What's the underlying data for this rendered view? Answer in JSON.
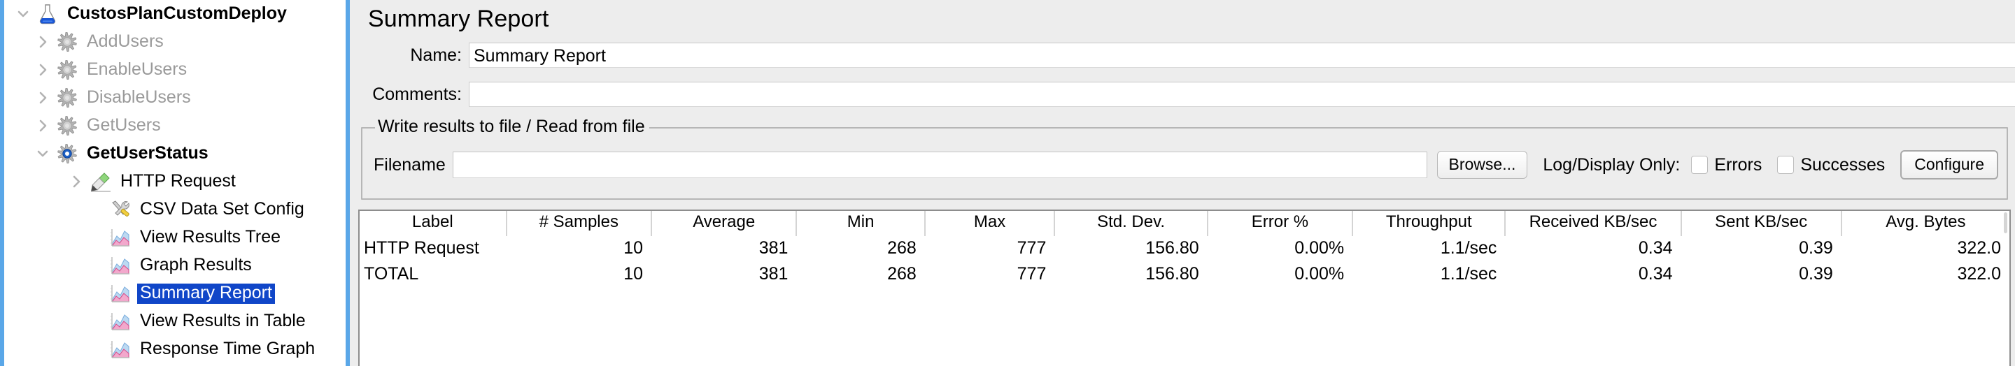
{
  "window": {
    "accent_color": "#5aa7e8",
    "panel_bg": "#ededed",
    "selection_color": "#1046c8"
  },
  "tree": {
    "items": [
      {
        "label": "CustosPlanCustomDeploy",
        "icon": "test-plan-flask-icon",
        "indent": 0,
        "twisty": "chevron-down-icon",
        "state": "enabled-bold",
        "selected": false
      },
      {
        "label": "AddUsers",
        "icon": "thread-group-gear-icon",
        "indent": 1,
        "twisty": "chevron-right-icon",
        "state": "disabled",
        "selected": false
      },
      {
        "label": "EnableUsers",
        "icon": "thread-group-gear-icon",
        "indent": 1,
        "twisty": "chevron-right-icon",
        "state": "disabled",
        "selected": false
      },
      {
        "label": "DisableUsers",
        "icon": "thread-group-gear-icon",
        "indent": 1,
        "twisty": "chevron-right-icon",
        "state": "disabled",
        "selected": false
      },
      {
        "label": "GetUsers",
        "icon": "thread-group-gear-icon",
        "indent": 1,
        "twisty": "chevron-right-icon",
        "state": "disabled",
        "selected": false
      },
      {
        "label": "GetUserStatus",
        "icon": "thread-group-gear-active-icon",
        "indent": 1,
        "twisty": "chevron-down-icon",
        "state": "enabled-bold",
        "selected": false
      },
      {
        "label": "HTTP Request",
        "icon": "http-request-pen-icon",
        "indent": 2,
        "twisty": "chevron-right-icon",
        "state": "enabled",
        "selected": false
      },
      {
        "label": "CSV Data Set Config",
        "icon": "csv-config-tools-icon",
        "indent": 3,
        "twisty": "none",
        "state": "enabled",
        "selected": false
      },
      {
        "label": "View Results Tree",
        "icon": "listener-chart-icon",
        "indent": 3,
        "twisty": "none",
        "state": "enabled",
        "selected": false
      },
      {
        "label": "Graph Results",
        "icon": "listener-chart-icon",
        "indent": 3,
        "twisty": "none",
        "state": "enabled",
        "selected": false
      },
      {
        "label": "Summary Report",
        "icon": "listener-chart-icon",
        "indent": 3,
        "twisty": "none",
        "state": "enabled",
        "selected": true
      },
      {
        "label": "View Results in Table",
        "icon": "listener-chart-icon",
        "indent": 3,
        "twisty": "none",
        "state": "enabled",
        "selected": false
      },
      {
        "label": "Response Time Graph",
        "icon": "listener-chart-icon",
        "indent": 3,
        "twisty": "none",
        "state": "enabled",
        "selected": false
      }
    ]
  },
  "panel": {
    "title": "Summary Report",
    "name_label": "Name:",
    "name_value": "Summary Report",
    "comments_label": "Comments:",
    "comments_value": "",
    "comments_placeholder": "",
    "file_group": {
      "title": "Write results to file / Read from file",
      "filename_label": "Filename",
      "filename_value": "",
      "filename_placeholder": "",
      "browse_label": "Browse...",
      "log_display_label": "Log/Display Only:",
      "errors_label": "Errors",
      "errors_checked": false,
      "successes_label": "Successes",
      "successes_checked": false,
      "configure_label": "Configure"
    }
  },
  "table": {
    "columns": [
      "Label",
      "# Samples",
      "Average",
      "Min",
      "Max",
      "Std. Dev.",
      "Error %",
      "Throughput",
      "Received KB/sec",
      "Sent KB/sec",
      "Avg. Bytes"
    ],
    "rows": [
      {
        "label": "HTTP Request",
        "samples": "10",
        "average": "381",
        "min": "268",
        "max": "777",
        "stddev": "156.80",
        "error_pct": "0.00%",
        "throughput": "1.1/sec",
        "received_kb": "0.34",
        "sent_kb": "0.39",
        "avg_bytes": "322.0"
      },
      {
        "label": "TOTAL",
        "samples": "10",
        "average": "381",
        "min": "268",
        "max": "777",
        "stddev": "156.80",
        "error_pct": "0.00%",
        "throughput": "1.1/sec",
        "received_kb": "0.34",
        "sent_kb": "0.39",
        "avg_bytes": "322.0"
      }
    ]
  }
}
